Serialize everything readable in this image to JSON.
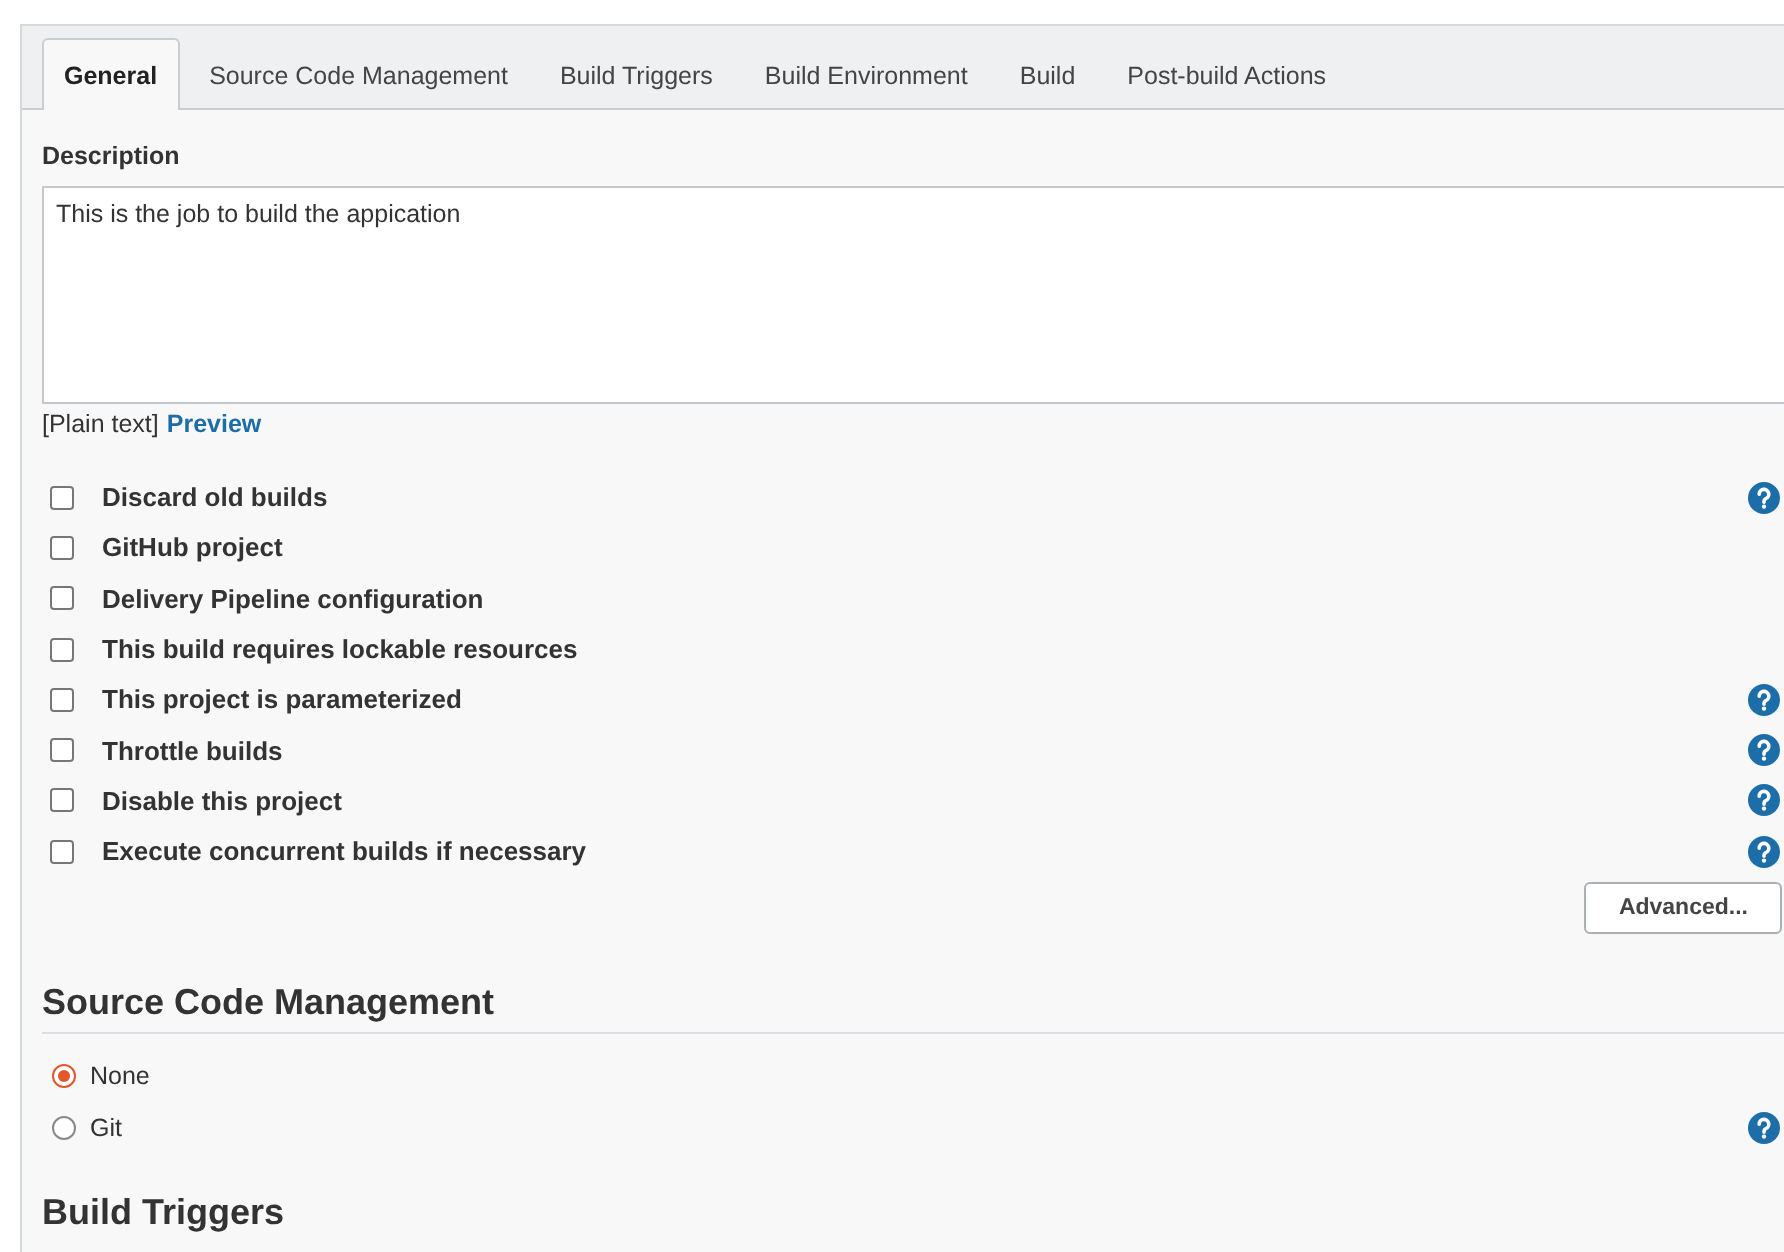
{
  "tabs": [
    {
      "label": "General",
      "selected": true
    },
    {
      "label": "Source Code Management",
      "selected": false
    },
    {
      "label": "Build Triggers",
      "selected": false
    },
    {
      "label": "Build Environment",
      "selected": false
    },
    {
      "label": "Build",
      "selected": false
    },
    {
      "label": "Post-build Actions",
      "selected": false
    }
  ],
  "description": {
    "label": "Description",
    "value": "This is the job to build the appication",
    "format": "[Plain text]",
    "preview_link": "Preview"
  },
  "options": [
    {
      "label": "Discard old builds",
      "checked": false,
      "help": true
    },
    {
      "label": "GitHub project",
      "checked": false,
      "help": false
    },
    {
      "label": "Delivery Pipeline configuration",
      "checked": false,
      "help": false
    },
    {
      "label": "This build requires lockable resources",
      "checked": false,
      "help": false
    },
    {
      "label": "This project is parameterized",
      "checked": false,
      "help": true
    },
    {
      "label": "Throttle builds",
      "checked": false,
      "help": true
    },
    {
      "label": "Disable this project",
      "checked": false,
      "help": true
    },
    {
      "label": "Execute concurrent builds if necessary",
      "checked": false,
      "help": true
    }
  ],
  "advanced_button": "Advanced...",
  "source_code_management": {
    "title": "Source Code Management",
    "options": [
      {
        "label": "None",
        "selected": true,
        "help": false
      },
      {
        "label": "Git",
        "selected": false,
        "help": true
      }
    ]
  },
  "build_triggers": {
    "title": "Build Triggers"
  }
}
